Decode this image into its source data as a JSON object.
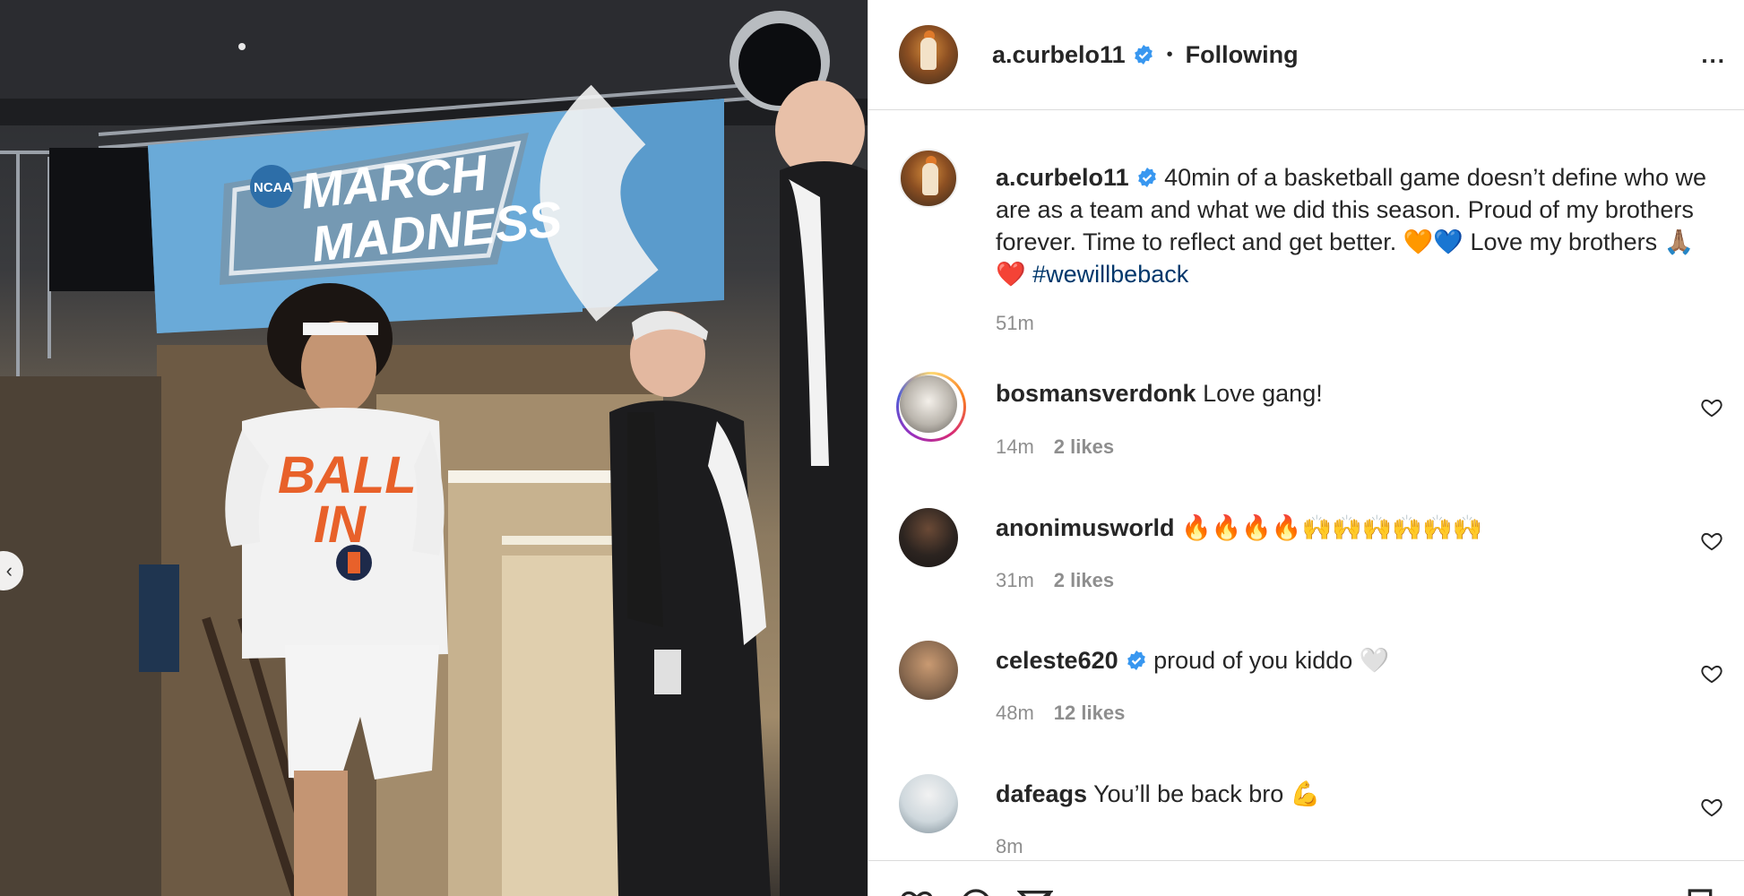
{
  "post": {
    "username": "a.curbelo11",
    "follow_status": "Following",
    "dot": "•",
    "more": "..."
  },
  "caption": {
    "username": "a.curbelo11",
    "text": "40min of a basketball game doesn’t define who we are as a team and what we did this season. Proud of my brothers forever. Time to reflect and get better. 🧡💙 Love my brothers 🙏🏽❤️",
    "hashtag": "#wewillbeback",
    "time": "51m"
  },
  "photo": {
    "banner_text_1": "MARCH",
    "banner_text_2": "MADNESS",
    "banner_logo": "NCAA",
    "shirt_text_1": "BALL",
    "shirt_text_2": "IN"
  },
  "comments": [
    {
      "username": "bosmansverdonk",
      "text": "Love gang!",
      "time": "14m",
      "likes": "2 likes",
      "verified": false
    },
    {
      "username": "anonimusworld",
      "text": "🔥🔥🔥🔥🙌🙌🙌🙌🙌🙌",
      "time": "31m",
      "likes": "2 likes",
      "verified": false
    },
    {
      "username": "celeste620",
      "text": "proud of you kiddo 🤍",
      "time": "48m",
      "likes": "12 likes",
      "verified": true
    },
    {
      "username": "dafeags",
      "text": "You’ll be back bro 💪",
      "time": "8m",
      "likes": "",
      "verified": false
    }
  ],
  "icons": {
    "verified": "verified-badge-icon",
    "heart": "heart-icon",
    "prev": "chevron-left-icon",
    "like": "like-icon",
    "comment": "comment-icon",
    "share": "share-icon",
    "save": "save-icon"
  },
  "colors": {
    "verified": "#3897f0",
    "hashtag": "#00376b",
    "secondary_text": "#8e8e8e",
    "divider": "#dbdbdb"
  }
}
